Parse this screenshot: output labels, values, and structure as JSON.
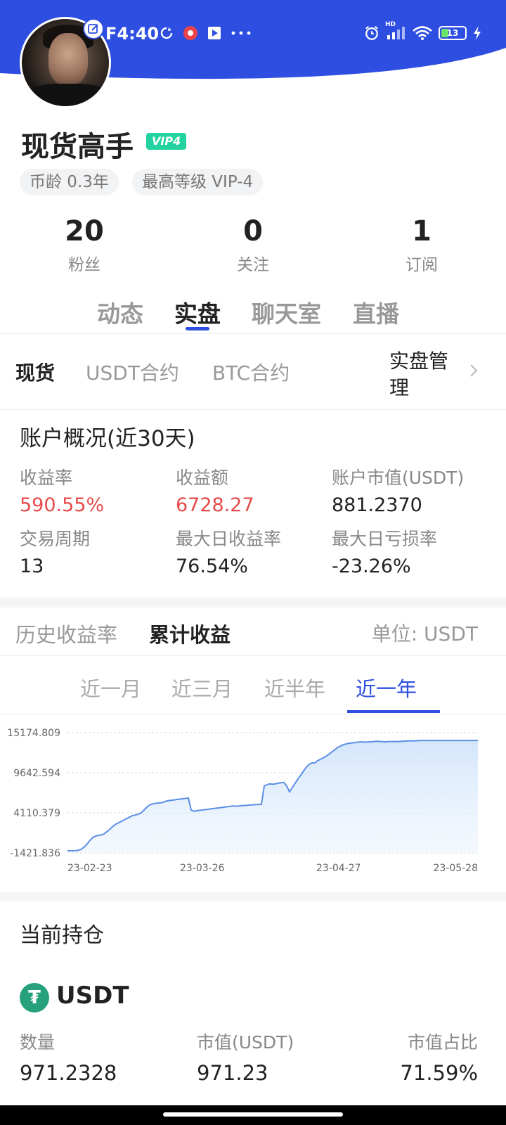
{
  "colors": {
    "header_blue": "#2d4ee0",
    "accent_red": "#e84a4a",
    "vip_green": "#22d3a0",
    "usdt_green": "#26a17b"
  },
  "status_bar": {
    "time": "F4:40",
    "battery": "13",
    "signal": "HD",
    "icons": [
      "edit-icon",
      "sync-icon",
      "record-icon",
      "play-icon",
      "more-icon",
      "alarm-icon",
      "signal-icon",
      "wifi-icon",
      "battery-icon",
      "charging-icon"
    ]
  },
  "profile": {
    "name": "现货高手",
    "vip": "VIP4",
    "tags": {
      "age": "币龄 0.3年",
      "level": "最高等级 VIP-4"
    }
  },
  "stats": {
    "fans": {
      "value": "20",
      "label": "粉丝"
    },
    "following": {
      "value": "0",
      "label": "关注"
    },
    "subscriptions": {
      "value": "1",
      "label": "订阅"
    }
  },
  "main_tabs": [
    "动态",
    "实盘",
    "聊天室",
    "直播"
  ],
  "sub_tabs": [
    "现货",
    "USDT合约",
    "BTC合约"
  ],
  "manage": {
    "line1": "实盘管",
    "line2": "理"
  },
  "overview": {
    "title": "账户概况(近30天)",
    "metrics": [
      {
        "label": "收益率",
        "value": "590.55%"
      },
      {
        "label": "收益额",
        "value": "6728.27"
      },
      {
        "label": "账户市值(USDT)",
        "value": "881.2370"
      },
      {
        "label": "交易周期",
        "value": "13"
      },
      {
        "label": "最大日收益率",
        "value": "76.54%"
      },
      {
        "label": "最大日亏损率",
        "value": "-23.26%"
      }
    ]
  },
  "chart_section": {
    "tabs": [
      "历史收益率",
      "累计收益"
    ],
    "unit": "单位: USDT",
    "ranges": [
      "近一月",
      "近三月",
      "近半年",
      "近一年"
    ]
  },
  "chart_data": {
    "type": "area",
    "y_ticks": [
      "15174.809",
      "9642.594",
      "4110.379",
      "-1421.836"
    ],
    "ylim": [
      -1421.836,
      15174.809
    ],
    "x_tick_labels": [
      "23-02-23",
      "23-03-26",
      "23-04-27",
      "23-05-28"
    ],
    "x": [
      0,
      4,
      8,
      12,
      16,
      20,
      24,
      28,
      32,
      36,
      40,
      44,
      48,
      52,
      56,
      60,
      64,
      68,
      72,
      76,
      80,
      84,
      88,
      92,
      96,
      100,
      104,
      108,
      112,
      116,
      120,
      124,
      128,
      132,
      136,
      140,
      144,
      148,
      152,
      156,
      160,
      164,
      168,
      172,
      176,
      180,
      184,
      188,
      192,
      196,
      200,
      204,
      208,
      212,
      216,
      220,
      224,
      228,
      232,
      236,
      240,
      244,
      248,
      252,
      256,
      260,
      264,
      268,
      272,
      276,
      280,
      284,
      288,
      292,
      296,
      300,
      304,
      308,
      312,
      316,
      320,
      324,
      328,
      332,
      336,
      340,
      344,
      348,
      352,
      356,
      360,
      364,
      368,
      372,
      376,
      380,
      384,
      388,
      392,
      396,
      400,
      404,
      408,
      412,
      416,
      420,
      424,
      428,
      432,
      436,
      440,
      444,
      448,
      452,
      456,
      460,
      464,
      468,
      472,
      476,
      480,
      484,
      488,
      492,
      496,
      500,
      504,
      508,
      512,
      516,
      520,
      524,
      528,
      532,
      536,
      540,
      544,
      548,
      552,
      556,
      560,
      564,
      568,
      572,
      576,
      580,
      584
    ],
    "values": [
      -1100,
      -1120,
      -1130,
      -1100,
      -1050,
      -900,
      -600,
      -200,
      300,
      700,
      900,
      1000,
      1050,
      1200,
      1500,
      1800,
      2200,
      2500,
      2700,
      2900,
      3100,
      3300,
      3500,
      3700,
      3800,
      3900,
      4050,
      4400,
      4800,
      5150,
      5300,
      5400,
      5450,
      5500,
      5550,
      5700,
      5800,
      5850,
      5900,
      5950,
      6000,
      6050,
      6100,
      6150,
      4500,
      4300,
      4400,
      4450,
      4500,
      4550,
      4600,
      4650,
      4700,
      4750,
      4800,
      4850,
      4900,
      4950,
      5000,
      5050,
      5000,
      5050,
      5100,
      5100,
      5150,
      5200,
      5200,
      5250,
      5250,
      5300,
      7800,
      8000,
      8100,
      8050,
      8100,
      8200,
      8250,
      8300,
      7800,
      7000,
      7600,
      8200,
      8800,
      9300,
      9900,
      10400,
      10800,
      11000,
      11000,
      11300,
      11500,
      11700,
      11900,
      12200,
      12500,
      12800,
      13100,
      13300,
      13500,
      13600,
      13700,
      13750,
      13800,
      13850,
      13900,
      13900,
      13850,
      13900,
      13900,
      13950,
      14000,
      13950,
      13950,
      13900,
      13950,
      13950,
      13950,
      13950,
      13950,
      14000,
      14000,
      14050,
      14050,
      14050,
      14050,
      14100,
      14100,
      14100,
      14100,
      14100,
      14100,
      14100,
      14100,
      14100,
      14100,
      14100,
      14100,
      14100,
      14100,
      14100,
      14100,
      14100,
      14100,
      14100,
      14100,
      14100,
      14100,
      14150,
      14200
    ],
    "grid": true
  },
  "holdings": {
    "title": "当前持仓",
    "coin": "USDT",
    "coin_symbol": "₮",
    "columns": [
      {
        "label": "数量",
        "value": "971.2328"
      },
      {
        "label": "市值(USDT)",
        "value": "971.23"
      },
      {
        "label": "市值占比",
        "value": "71.59%"
      }
    ]
  }
}
